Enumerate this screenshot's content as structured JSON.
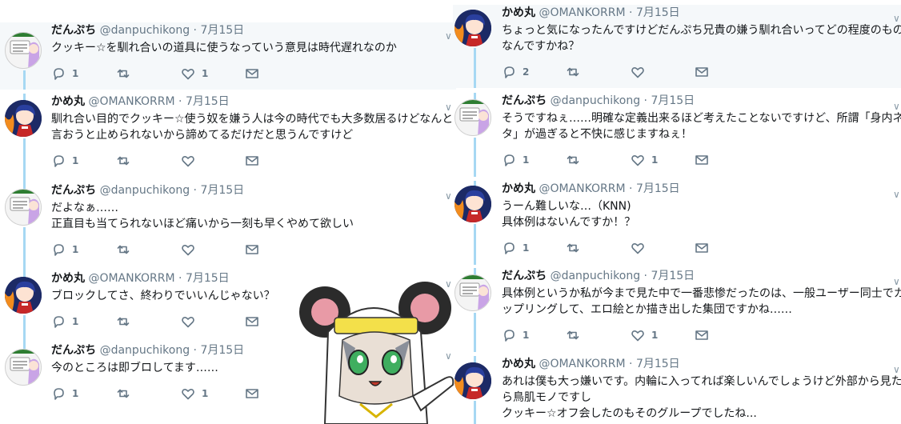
{
  "left_tweets": [
    {
      "name": "だんぷち",
      "handle": "@danpuchikong",
      "sep": "·",
      "date": "7月15日",
      "lines": [
        "クッキー☆を馴れ合いの道具に使うなっていう意見は時代遅れなのか"
      ],
      "reply_count": "1",
      "retweet_count": "",
      "like_count": "1"
    },
    {
      "name": "かめ丸",
      "handle": "@OMANKORRM",
      "sep": "·",
      "date": "7月15日",
      "lines": [
        "馴れ合い目的でクッキー☆使う奴を嫌う人は今の時代でも大多数居るけどなんと",
        "言おうと止められないから諦めてるだけだと思うんですけど"
      ],
      "reply_count": "1",
      "retweet_count": "",
      "like_count": ""
    },
    {
      "name": "だんぷち",
      "handle": "@danpuchikong",
      "sep": "·",
      "date": "7月15日",
      "lines": [
        "だよなぁ……",
        "正直目も当てられないほど痛いから一刻も早くやめて欲しい"
      ],
      "reply_count": "1",
      "retweet_count": "",
      "like_count": ""
    },
    {
      "name": "かめ丸",
      "handle": "@OMANKORRM",
      "sep": "·",
      "date": "7月15日",
      "lines": [
        "ブロックしてさ、終わりでいいんじゃない？"
      ],
      "reply_count": "1",
      "retweet_count": "",
      "like_count": ""
    },
    {
      "name": "だんぷち",
      "handle": "@danpuchikong",
      "sep": "·",
      "date": "7月15日",
      "lines": [
        "今のところは即ブロしてます……"
      ],
      "reply_count": "1",
      "retweet_count": "",
      "like_count": "1"
    }
  ],
  "right_tweets": [
    {
      "name": "かめ丸",
      "handle": "@OMANKORRM",
      "sep": "·",
      "date": "7月15日",
      "lines": [
        "ちょっと気になったんですけどだんぷち兄貴の嫌う馴れ合いってどの程度のもの",
        "なんですかね？"
      ],
      "reply_count": "2",
      "retweet_count": "",
      "like_count": ""
    },
    {
      "name": "だんぷち",
      "handle": "@danpuchikong",
      "sep": "·",
      "date": "7月15日",
      "lines": [
        "そうですねぇ……明確な定義出来るほど考えたことないですけど、所謂「身内ネ",
        "タ」が過ぎると不快に感じますねぇ！"
      ],
      "reply_count": "1",
      "retweet_count": "",
      "like_count": "1"
    },
    {
      "name": "かめ丸",
      "handle": "@OMANKORRM",
      "sep": "·",
      "date": "7月15日",
      "lines": [
        "うーん難しいな…（KNN)",
        "具体例はないんですか！？"
      ],
      "reply_count": "1",
      "retweet_count": "",
      "like_count": ""
    },
    {
      "name": "だんぷち",
      "handle": "@danpuchikong",
      "sep": "·",
      "date": "7月15日",
      "lines": [
        "具体例というか私が今まで見た中で一番悲惨だったのは、一般ユーザー同士でカ",
        "ップリングして、エロ絵とか描き出した集団ですかね……"
      ],
      "reply_count": "1",
      "retweet_count": "",
      "like_count": "1"
    },
    {
      "name": "かめ丸",
      "handle": "@OMANKORRM",
      "sep": "·",
      "date": "7月15日",
      "lines": [
        "あれは僕も大っ嫌いです。内輪に入ってれば楽しいんでしょうけど外部から見た",
        "ら鳥肌モノですし",
        "クッキー☆オフ会したのもそのグループでしたね..."
      ],
      "reply_count": "",
      "retweet_count": "",
      "like_count": ""
    }
  ],
  "colors": {
    "text": "#14171a",
    "secondary": "#657786",
    "thread_line": "#a6d8f3",
    "highlight_bg": "#f5f8fa"
  },
  "icons": {
    "reply": "reply-icon",
    "retweet": "retweet-icon",
    "like": "heart-icon",
    "dm": "envelope-icon",
    "caret": "chevron-down-icon",
    "caret_glyph": "∨"
  }
}
